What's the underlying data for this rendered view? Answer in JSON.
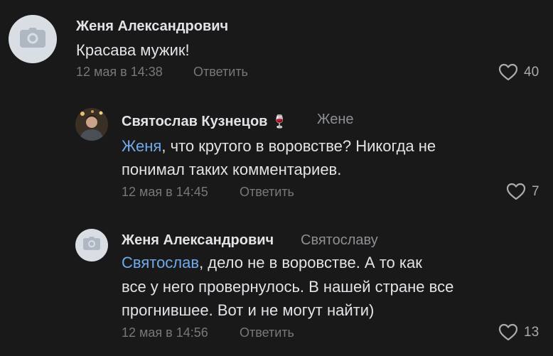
{
  "comments": [
    {
      "author": "Женя Александрович",
      "text": "Красава мужик!",
      "date": "12 мая в 14:38",
      "reply_label": "Ответить",
      "likes": "40",
      "avatar_icon": "camera-icon"
    },
    {
      "author": "Святослав Кузнецов",
      "author_badge": "🍷",
      "reply_to": "Жене",
      "mention": "Женя",
      "text_line1": ", что крутого в воровстве? Никогда не",
      "text_line2": "понимал таких комментариев.",
      "date": "12 мая в 14:45",
      "reply_label": "Ответить",
      "likes": "7"
    },
    {
      "author": "Женя Александрович",
      "reply_to": "Святославу",
      "mention": "Святослав",
      "text_line1": ", дело не в воровстве. А то как",
      "text_line2": "все у него провернулось. В нашей стране все",
      "text_line3": "прогнившее. Вот и не могут найти)",
      "date": "12 мая в 14:56",
      "reply_label": "Ответить",
      "likes": "13",
      "avatar_icon": "camera-icon"
    }
  ],
  "colors": {
    "background": "#19191a",
    "text": "#e1e3e6",
    "secondary": "#76787a",
    "mention": "#71aaeb",
    "avatar_placeholder": "#d9dee4"
  }
}
